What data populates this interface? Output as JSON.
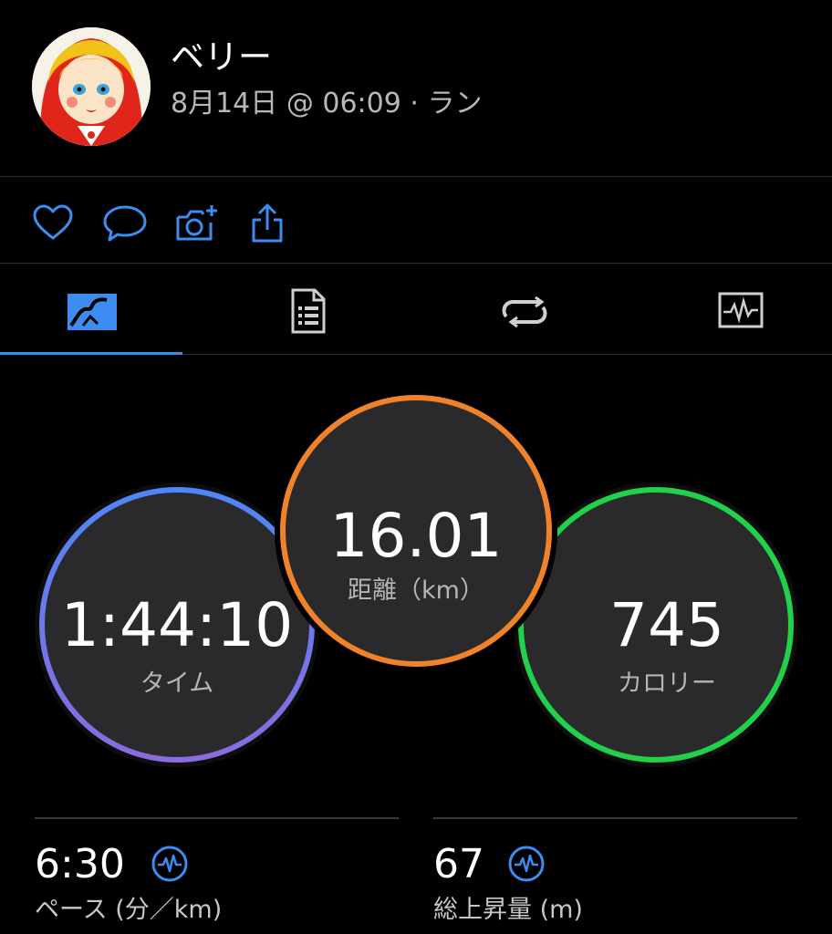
{
  "header": {
    "username": "ベリー",
    "date": "8月14日",
    "at": "@",
    "time": "06:09",
    "sep": "·",
    "activity": "ラン"
  },
  "actions": {
    "icons": [
      "heart-icon",
      "comment-icon",
      "add-photo-icon",
      "share-icon"
    ],
    "accent": "#3d8df0"
  },
  "tabs": {
    "items": [
      "overview-tab",
      "details-tab",
      "laps-tab",
      "charts-tab"
    ],
    "active_index": 0,
    "active_color": "#3d8df0",
    "inactive_color": "#d0d0d0"
  },
  "metrics": {
    "time": {
      "value": "1:44:10",
      "label": "タイム",
      "color_top": "#4f86f7",
      "color_bottom": "#8a6be0"
    },
    "distance": {
      "value": "16.01",
      "label": "距離（km）",
      "color": "#f0832a"
    },
    "calories": {
      "value": "745",
      "label": "カロリー",
      "color": "#22d14a"
    }
  },
  "stats": {
    "pace": {
      "value": "6:30",
      "label": "ペース (分／km)"
    },
    "elevation": {
      "value": "67",
      "label": "総上昇量 (m)"
    }
  }
}
